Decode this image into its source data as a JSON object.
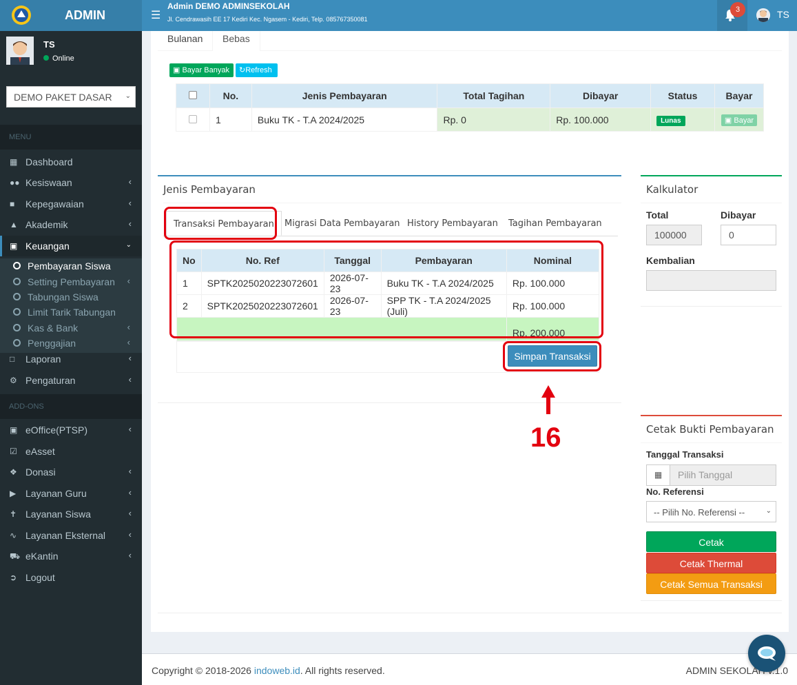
{
  "app": {
    "logo_text": "ADMIN",
    "header_title": "Admin DEMO ADMINSEKOLAH",
    "header_address": "Jl. Cendrawasih EE 17 Kediri Kec. Ngasem - Kediri, Telp. 085767350081",
    "notif_count": "3",
    "user_short": "TS"
  },
  "sidebar": {
    "user_name": "TS",
    "user_status": "Online",
    "school_select": "DEMO PAKET DASAR",
    "menu_header": "MENU",
    "addons_header": "ADD-ONS",
    "items": [
      {
        "label": "Dashboard",
        "icon": "dashboard-icon"
      },
      {
        "label": "Kesiswaan",
        "icon": "users-icon"
      },
      {
        "label": "Kepegawaian",
        "icon": "briefcase-icon"
      },
      {
        "label": "Akademik",
        "icon": "graduation-cap-icon"
      },
      {
        "label": "Keuangan",
        "icon": "money-icon"
      },
      {
        "label": "Laporan",
        "icon": "file-icon"
      },
      {
        "label": "Pengaturan",
        "icon": "gear-icon"
      },
      {
        "label": "eOffice(PTSP)",
        "icon": "archive-icon"
      },
      {
        "label": "eAsset",
        "icon": "check-square-icon"
      },
      {
        "label": "Donasi",
        "icon": "dropbox-icon"
      },
      {
        "label": "Layanan Guru",
        "icon": "bullhorn-icon"
      },
      {
        "label": "Layanan Siswa",
        "icon": "child-icon"
      },
      {
        "label": "Layanan Eksternal",
        "icon": "rss-icon"
      },
      {
        "label": "eKantin",
        "icon": "cart-icon"
      },
      {
        "label": "Logout",
        "icon": "sign-out-icon"
      }
    ],
    "keuangan_sub": [
      "Pembayaran Siswa",
      "Setting Pembayaran",
      "Tabungan Siswa",
      "Limit Tarik Tabungan",
      "Kas & Bank",
      "Penggajian"
    ]
  },
  "tabs_top": [
    "Bulanan",
    "Bebas"
  ],
  "bebas": {
    "bayar_banyak": "Bayar Banyak",
    "refresh": "Refresh",
    "headers": [
      "No.",
      "Jenis Pembayaran",
      "Total Tagihan",
      "Dibayar",
      "Status",
      "Bayar"
    ],
    "rows": [
      {
        "no": "1",
        "jenis": "Buku TK - T.A 2024/2025",
        "total": "Rp. 0",
        "dibayar": "Rp. 100.000",
        "status": "Lunas",
        "bayar": "Bayar"
      }
    ]
  },
  "jenis": {
    "title": "Jenis Pembayaran",
    "tabs": [
      "Transaksi Pembayaran",
      "Migrasi Data Pembayaran",
      "History Pembayaran",
      "Tagihan Pembayaran"
    ],
    "headers": [
      "No",
      "No. Ref",
      "Tanggal",
      "Pembayaran",
      "Nominal"
    ],
    "rows": [
      {
        "no": "1",
        "ref": "SPTK2025020223072601",
        "tanggal": "2026-07-23",
        "pembayaran": "Buku TK - T.A 2024/2025",
        "nominal": "Rp. 100.000"
      },
      {
        "no": "2",
        "ref": "SPTK2025020223072601",
        "tanggal": "2026-07-23",
        "pembayaran": "SPP TK - T.A 2024/2025 (Juli)",
        "nominal": "Rp. 100.000"
      }
    ],
    "total": "Rp. 200.000",
    "simpan": "Simpan Transaksi"
  },
  "annotation": {
    "step": "16"
  },
  "kalkulator": {
    "title": "Kalkulator",
    "total_label": "Total",
    "total_value": "100000",
    "dibayar_label": "Dibayar",
    "dibayar_value": "0",
    "kembalian_label": "Kembalian"
  },
  "cetak": {
    "title": "Cetak Bukti Pembayaran",
    "tanggal_label": "Tanggal Transaksi",
    "tanggal_placeholder": "Pilih Tanggal",
    "ref_label": "No. Referensi",
    "ref_select": "-- Pilih No. Referensi --",
    "btn_cetak": "Cetak",
    "btn_thermal": "Cetak Thermal",
    "btn_semua": "Cetak Semua Transaksi"
  },
  "footer": {
    "copy": "Copyright © 2018-2026 ",
    "link": "indoweb.id",
    "rights": ". All rights reserved.",
    "right": "ADMIN SEKOLAH v.1.0"
  },
  "colors": {
    "primary": "#3c8dbc",
    "success": "#00a65a",
    "danger": "#dd4b39",
    "warning": "#f39c12",
    "annotation": "#e3000f"
  }
}
